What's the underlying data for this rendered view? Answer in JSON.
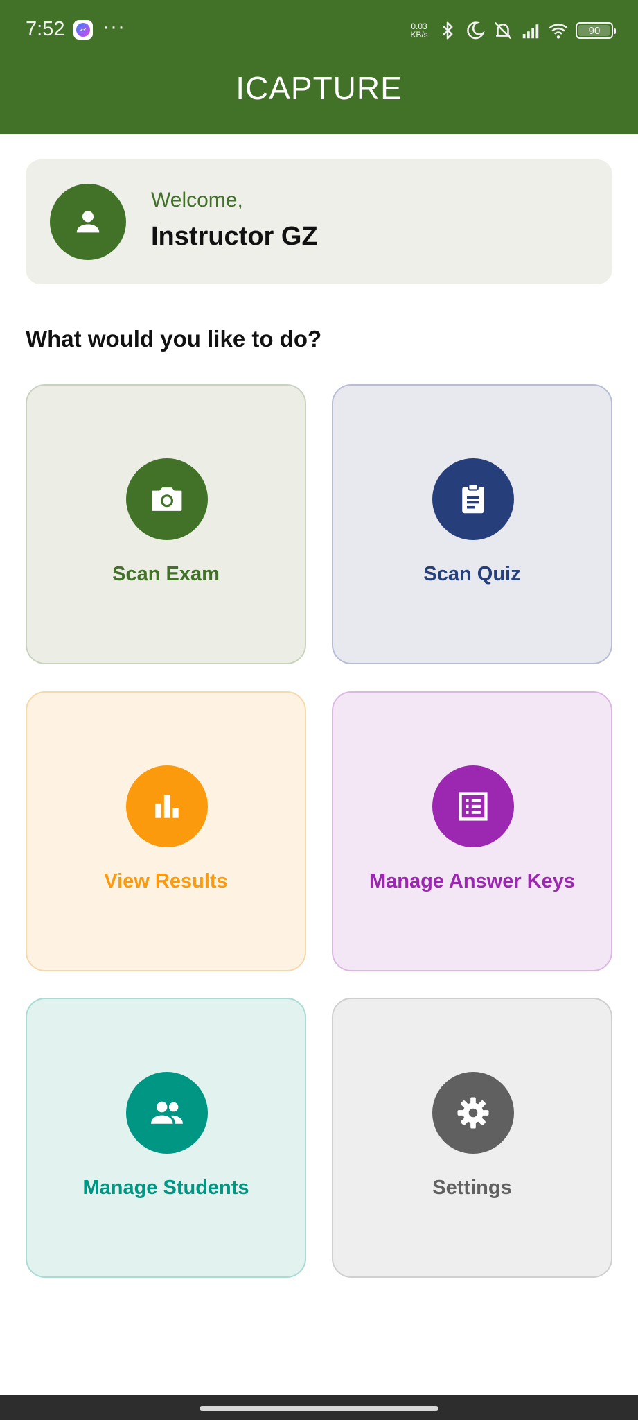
{
  "status_bar": {
    "time": "7:52",
    "net_speed_value": "0.03",
    "net_speed_unit": "KB/s",
    "battery": "90",
    "battery_level": 0.9,
    "icons": [
      "messenger-icon",
      "more-dots-icon",
      "bluetooth-icon",
      "moon-icon",
      "vibrate-off-icon",
      "signal-icon",
      "wifi-icon",
      "battery-icon"
    ]
  },
  "app_bar": {
    "title": "ICAPTURE"
  },
  "welcome": {
    "greeting": "Welcome,",
    "name": "Instructor GZ",
    "avatar_icon": "person-icon"
  },
  "prompt": "What would you like to do?",
  "tiles": [
    {
      "label": "Scan Exam",
      "icon": "camera-icon",
      "color": "#427128"
    },
    {
      "label": "Scan Quiz",
      "icon": "clipboard-icon",
      "color": "#263f7a"
    },
    {
      "label": "View Results",
      "icon": "bar-chart-icon",
      "color": "#fb9a0c"
    },
    {
      "label": "Manage Answer Keys",
      "icon": "list-alt-icon",
      "color": "#9c27b0"
    },
    {
      "label": "Manage Students",
      "icon": "people-icon",
      "color": "#009684"
    },
    {
      "label": "Settings",
      "icon": "gear-icon",
      "color": "#606060"
    }
  ],
  "colors": {
    "primary": "#427128",
    "surface": "#edefe8"
  }
}
